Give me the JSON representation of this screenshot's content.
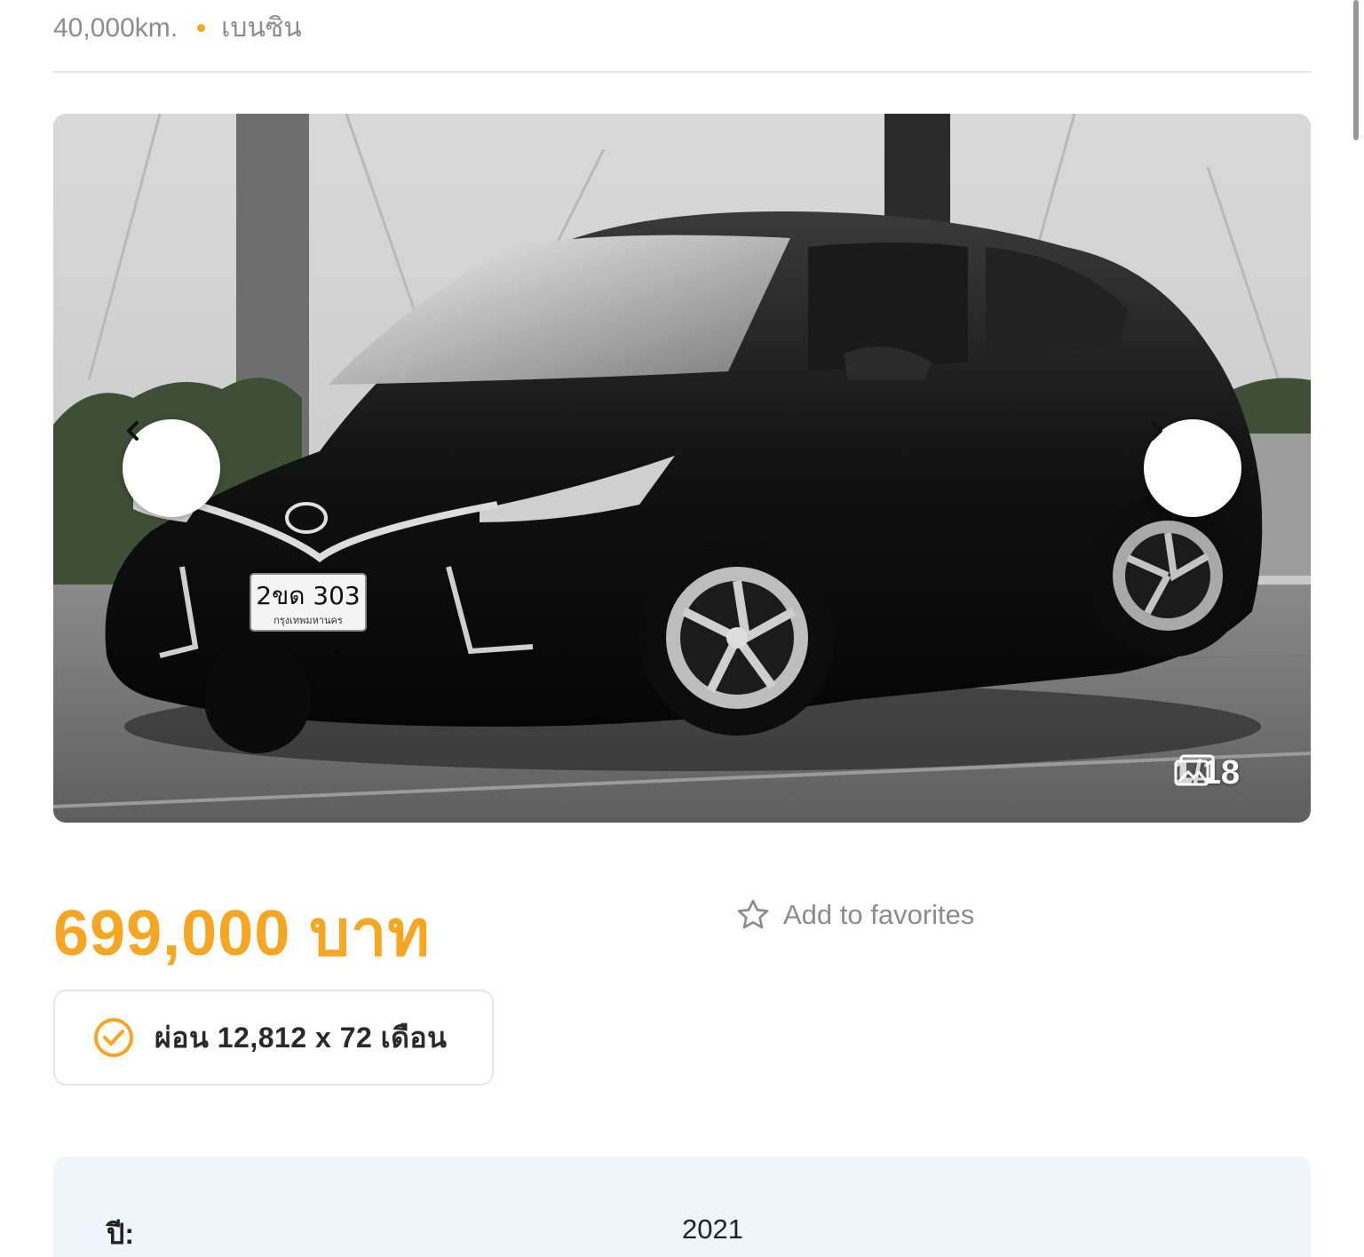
{
  "listing": {
    "mileage": "40,000km.",
    "fuel": "เบนซิน"
  },
  "gallery": {
    "plate_number": "2ขด 303",
    "plate_city": "กรุงเทพมหานคร",
    "counter": "1/18",
    "current_image": 1,
    "total_images": 18
  },
  "pricing": {
    "price": "699,000 บาท",
    "favorite_label": "Add to favorites",
    "installment": "ผ่อน 12,812 x 72 เดือน"
  },
  "specs": {
    "rows": [
      {
        "label": "ปี:",
        "value": "2021"
      }
    ]
  },
  "colors": {
    "accent": "#f5a623",
    "muted_text": "#8c8c8c",
    "spec_bg": "#f0f4fb"
  },
  "icons": {
    "prev": "chevron-left-icon",
    "next": "chevron-right-icon",
    "gallery": "images-stack-icon",
    "favorite": "star-outline-icon",
    "installment": "check-circle-icon"
  }
}
